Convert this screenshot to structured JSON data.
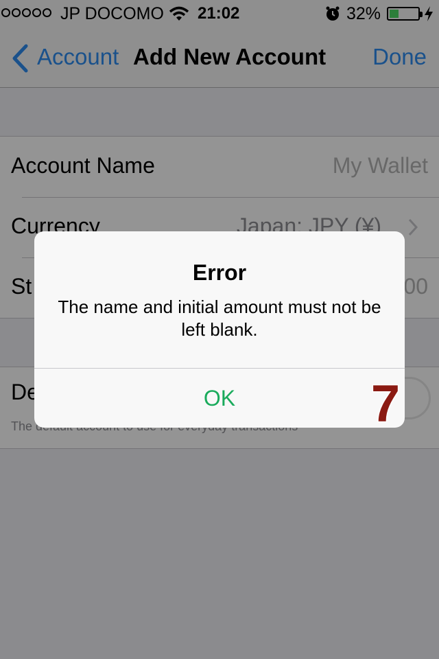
{
  "status_bar": {
    "carrier": "JP DOCOMO",
    "time": "21:02",
    "battery_percent": "32%",
    "battery_level": 0.32,
    "icons": [
      "signal-dots",
      "wifi-icon",
      "alarm-icon",
      "battery-icon",
      "bolt-icon"
    ]
  },
  "nav": {
    "back_label": "Account",
    "title": "Add New Account",
    "done_label": "Done"
  },
  "form": {
    "account_name": {
      "label": "Account Name",
      "placeholder": "My Wallet"
    },
    "currency": {
      "label": "Currency",
      "value": "Japan: JPY (¥)"
    },
    "starting": {
      "label": "St",
      "value": "00"
    },
    "default": {
      "label": "De",
      "note": "The default account to use for everyday transactions",
      "switch_on": false
    }
  },
  "alert": {
    "title": "Error",
    "message": "The name and initial amount must not be left blank.",
    "ok_label": "OK"
  },
  "annotation": {
    "step_number": "7",
    "color": "#8b1a12"
  },
  "colors": {
    "accent": "#2d8cf0",
    "ok": "#1aab5c",
    "battery": "#4cd964"
  }
}
